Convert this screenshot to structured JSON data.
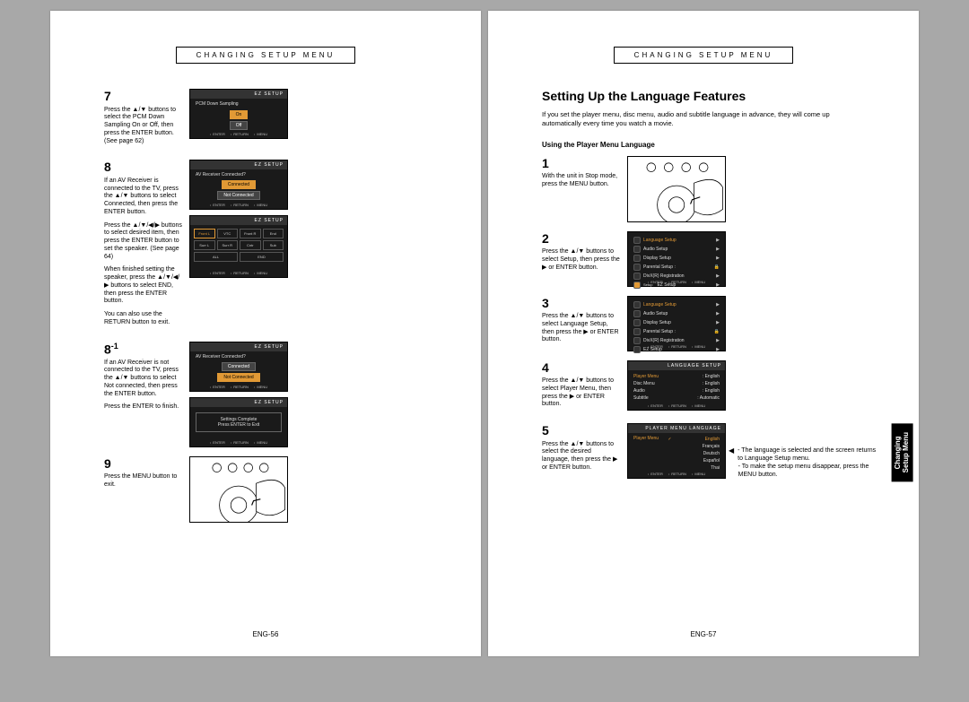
{
  "left": {
    "header": "CHANGING SETUP MENU",
    "footer": "ENG-56",
    "steps": {
      "s7": {
        "num": "7",
        "p1": "Press the ▲/▼ buttons to select the PCM Down Sampling On or Off, then press the ENTER button. (See page 62)",
        "screen_title": "EZ SETUP",
        "screen_label": "PCM Down Sampling",
        "opt_on": "On",
        "opt_off": "Off"
      },
      "s8": {
        "num": "8",
        "p1": "If an AV Receiver is connected to the TV, press the ▲/▼ buttons to select Connected, then press the ENTER button.",
        "p2": "Press the ▲/▼/◀/▶ buttons to select desired item, then press the ENTER button to set the speaker. (See page 64)",
        "p3": "When finished setting the speaker, press the ▲/▼/◀/▶ buttons to select END, then press the ENTER button.",
        "p4": "You can also use the RETURN button to exit.",
        "screen1_title": "EZ SETUP",
        "screen1_label": "AV Receiver Connected?",
        "screen1_opt1": "Connected",
        "screen1_opt2": "Not Connected",
        "screen2_title": "EZ SETUP"
      },
      "s8_1": {
        "num": "8",
        "sup": "-1",
        "p1": "If an AV Receiver is not connected to the TV, press the ▲/▼ buttons to select Not connected, then press the ENTER button.",
        "p2": "Press the ENTER to finish.",
        "screen1_title": "EZ SETUP",
        "screen1_label": "AV Receiver Connected?",
        "screen1_opt1": "Connected",
        "screen1_opt2": "Not Connected",
        "screen2_title": "EZ SETUP",
        "screen2_msg1": "Settings Complete",
        "screen2_msg2": "Press ENTER to Exit"
      },
      "s9": {
        "num": "9",
        "p1": "Press the MENU button to exit."
      }
    }
  },
  "right": {
    "header": "CHANGING SETUP MENU",
    "footer": "ENG-57",
    "tab": "Changing\nSetup Menu",
    "title": "Setting Up the Language Features",
    "intro": "If you set the player menu, disc menu, audio and subtitle language in advance, they will come up automatically every time you watch a movie.",
    "subhead": "Using the Player Menu Language",
    "steps": {
      "s1": {
        "num": "1",
        "p1": "With the unit in Stop mode, press the MENU button."
      },
      "s2": {
        "num": "2",
        "p1": "Press the ▲/▼ buttons to select Setup, then press the ▶ or ENTER button.",
        "menu": [
          "Language Setup",
          "Audio Setup",
          "Display Setup",
          "Parental Setup :",
          "DivX(R) Registration",
          "EZ Setup"
        ]
      },
      "s3": {
        "num": "3",
        "p1": "Press the ▲/▼ buttons to select Language Setup, then press the ▶ or ENTER button.",
        "menu": [
          "Language Setup",
          "Audio Setup",
          "Display Setup",
          "Parental Setup :",
          "DivX(R) Registration",
          "EZ Setup"
        ]
      },
      "s4": {
        "num": "4",
        "p1": "Press the ▲/▼ buttons to select Player Menu, then press the ▶ or ENTER button.",
        "screen_title": "LANGUAGE SETUP",
        "rows": [
          [
            "Player Menu",
            ": English"
          ],
          [
            "Disc Menu",
            ": English"
          ],
          [
            "Audio",
            ": English"
          ],
          [
            "Subtitle",
            ": Automatic"
          ]
        ]
      },
      "s5": {
        "num": "5",
        "p1": "Press the ▲/▼ buttons to select the desired language, then press the ▶ or ENTER button.",
        "screen_title": "PLAYER MENU LANGUAGE",
        "row_label": "Player Menu",
        "langs": [
          "English",
          "Français",
          "Deutsch",
          "Español",
          "Thai"
        ]
      }
    },
    "note": {
      "lead": "◀",
      "l1": "- The language is selected and the screen returns to Language Setup menu.",
      "l2": "- To make the setup menu disappear, press the MENU button."
    },
    "nav_labels": {
      "enter": "ENTER",
      "return": "RETURN",
      "menu": "MENU"
    }
  }
}
